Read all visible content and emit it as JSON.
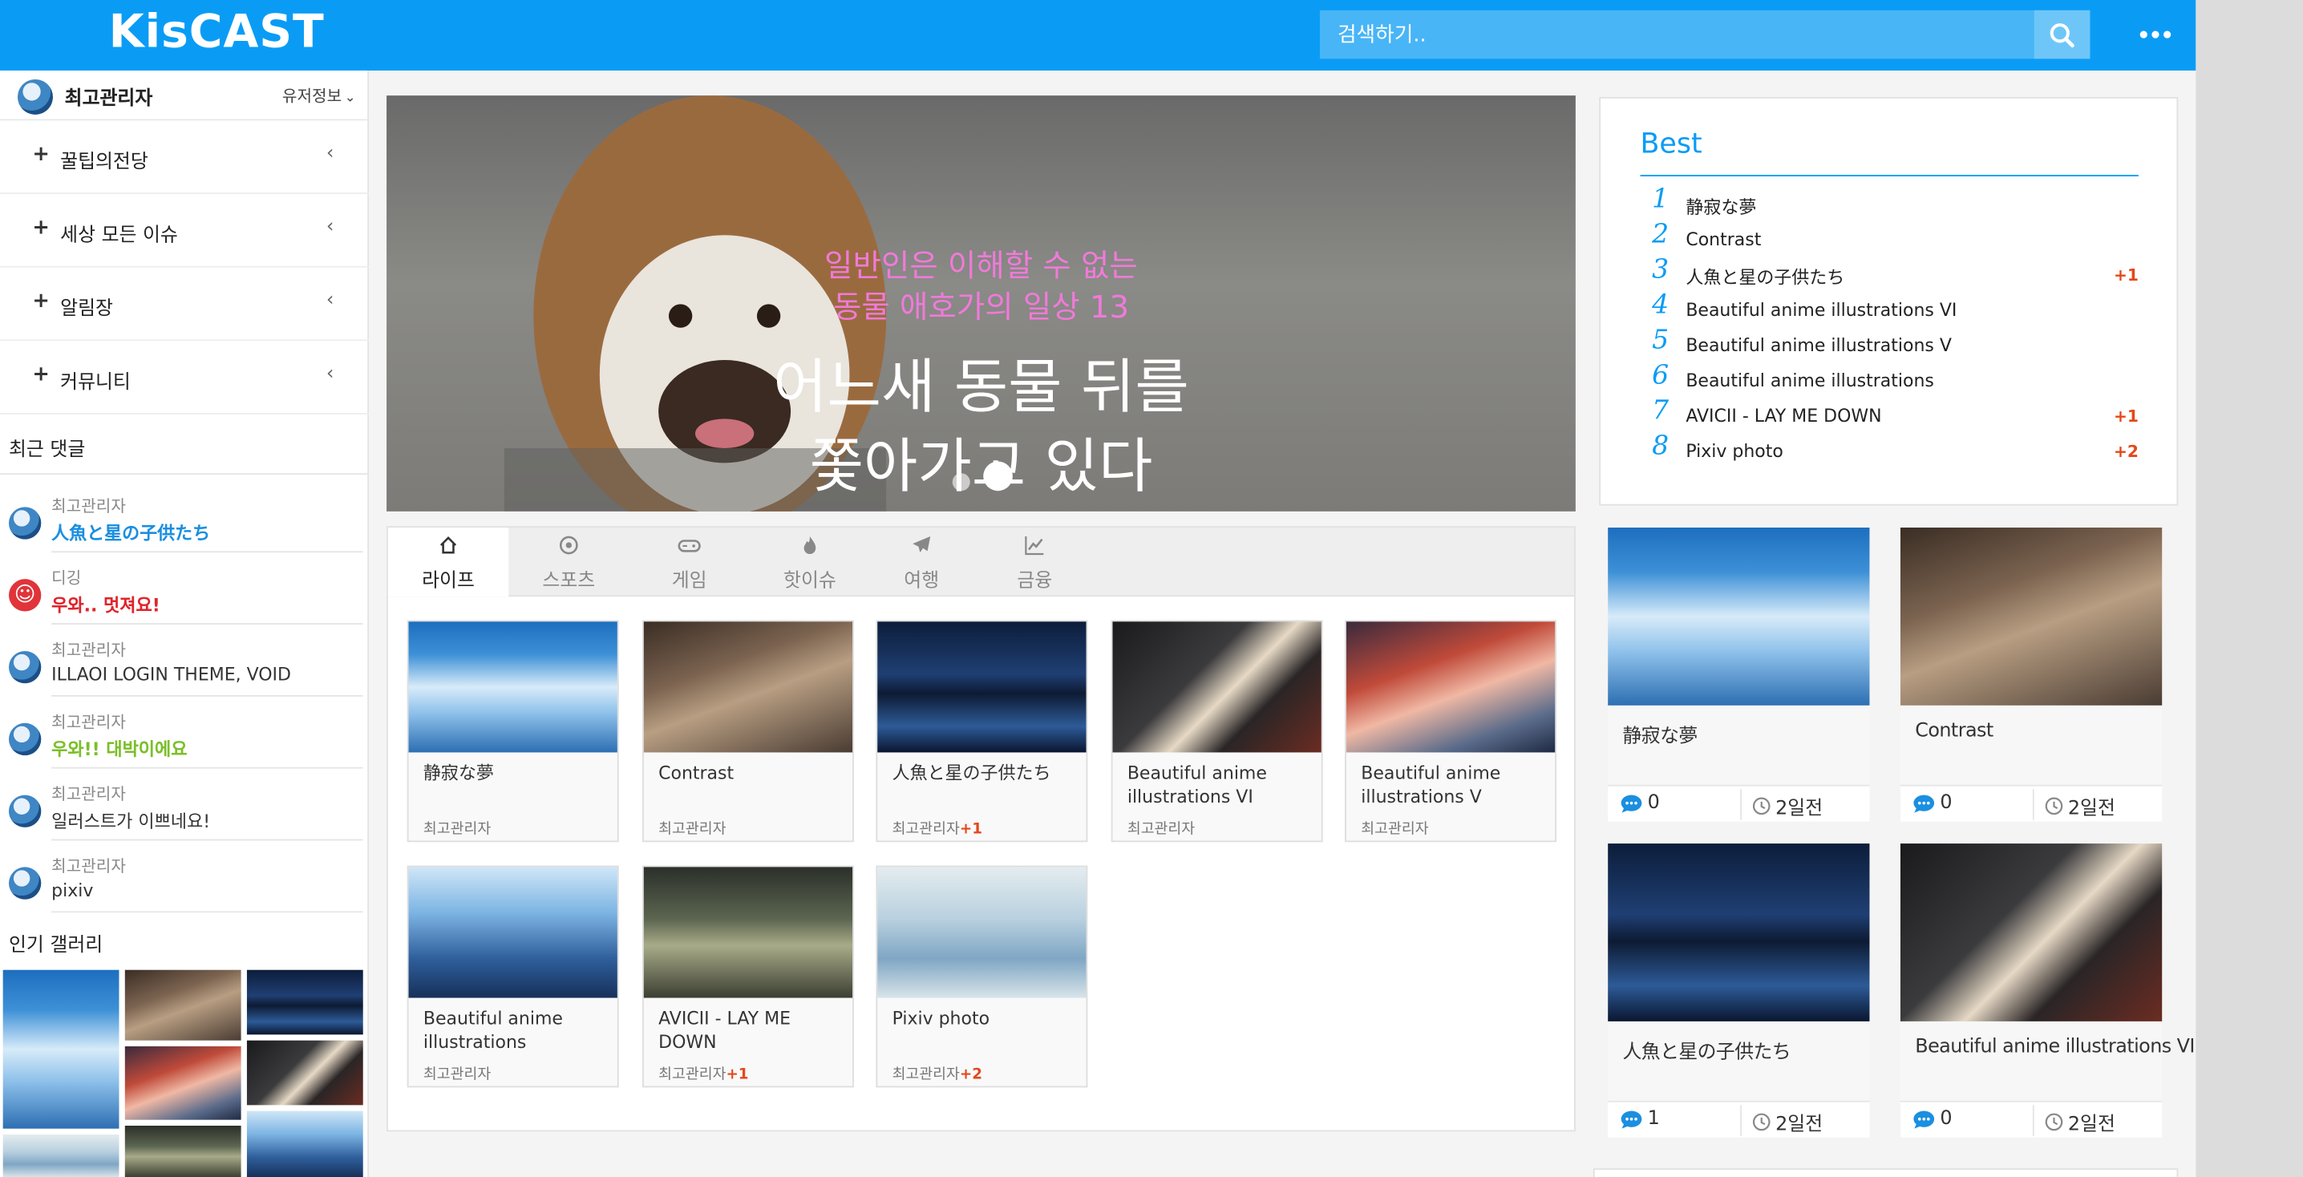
{
  "header": {
    "logo": "KisCAST",
    "search_placeholder": "검색하기..",
    "colors": {
      "brand": "#0a9cf5"
    }
  },
  "sidebar": {
    "user_name": "최고관리자",
    "user_info": "유저정보",
    "menu": [
      {
        "label": "꿀팁의전당"
      },
      {
        "label": "세상 모든 이슈"
      },
      {
        "label": "알림장"
      },
      {
        "label": "커뮤니티"
      }
    ],
    "recent_comments_title": "최근 댓글",
    "recent_comments": [
      {
        "author": "최고관리자",
        "message": "人魚と星の子供たち",
        "color": "#1b8fe0"
      },
      {
        "author": "디깅",
        "message": "우와.. 멋져요!",
        "color": "#e0242b"
      },
      {
        "author": "최고관리자",
        "message": "ILLAOI LOGIN THEME, VOID",
        "color": "#333333"
      },
      {
        "author": "최고관리자",
        "message": "우와!! 대박이에요",
        "color": "#7cbf2a"
      },
      {
        "author": "최고관리자",
        "message": "일러스트가 이쁘네요!",
        "color": "#333333"
      },
      {
        "author": "최고관리자",
        "message": "pixiv",
        "color": "#333333"
      }
    ],
    "gallery_title": "인기 갤러리"
  },
  "banner": {
    "subtitle_line1": "일반인은 이해할 수 없는",
    "subtitle_line2": "동물 애호가의 일상 13",
    "title_line1": "어느새 동물 뒤를",
    "title_line2": "쫓아가고 있다"
  },
  "tabs": [
    {
      "label": "라이프",
      "icon": "home-icon"
    },
    {
      "label": "스포츠",
      "icon": "soccer-ball-icon"
    },
    {
      "label": "게임",
      "icon": "gamepad-icon"
    },
    {
      "label": "핫이슈",
      "icon": "flame-icon"
    },
    {
      "label": "여행",
      "icon": "airplane-icon"
    },
    {
      "label": "금융",
      "icon": "chart-icon"
    }
  ],
  "cards": [
    {
      "title": "静寂な夢",
      "author": "최고관리자",
      "delta": ""
    },
    {
      "title": "Contrast",
      "author": "최고관리자",
      "delta": ""
    },
    {
      "title": "人魚と星の子供たち",
      "author": "최고관리자",
      "delta": "+1"
    },
    {
      "title": "Beautiful anime illustrations VI",
      "author": "최고관리자",
      "delta": ""
    },
    {
      "title": "Beautiful anime illustrations V",
      "author": "최고관리자",
      "delta": ""
    },
    {
      "title": "Beautiful anime illustrations",
      "author": "최고관리자",
      "delta": ""
    },
    {
      "title": "AVICII - LAY ME DOWN",
      "author": "최고관리자",
      "delta": "+1"
    },
    {
      "title": "Pixiv photo",
      "author": "최고관리자",
      "delta": "+2"
    }
  ],
  "best": {
    "title": "Best",
    "items": [
      {
        "rank": "1",
        "title": "静寂な夢",
        "delta": ""
      },
      {
        "rank": "2",
        "title": "Contrast",
        "delta": ""
      },
      {
        "rank": "3",
        "title": "人魚と星の子供たち",
        "delta": "+1"
      },
      {
        "rank": "4",
        "title": "Beautiful anime illustrations VI",
        "delta": ""
      },
      {
        "rank": "5",
        "title": "Beautiful anime illustrations V",
        "delta": ""
      },
      {
        "rank": "6",
        "title": "Beautiful anime illustrations",
        "delta": ""
      },
      {
        "rank": "7",
        "title": "AVICII - LAY ME DOWN",
        "delta": "+1"
      },
      {
        "rank": "8",
        "title": "Pixiv photo",
        "delta": "+2"
      }
    ]
  },
  "right_cards": [
    {
      "title": "静寂な夢",
      "comments": "0",
      "time": "2일전"
    },
    {
      "title": "Contrast",
      "comments": "0",
      "time": "2일전"
    },
    {
      "title": "人魚と星の子供たち",
      "comments": "1",
      "time": "2일전"
    },
    {
      "title": "Beautiful anime illustrations VI",
      "comments": "0",
      "time": "2일전"
    }
  ]
}
